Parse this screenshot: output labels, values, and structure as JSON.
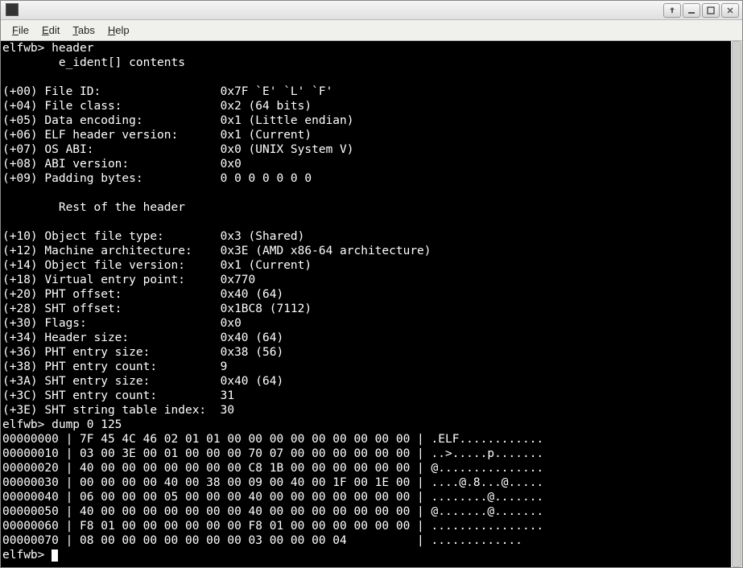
{
  "menubar": {
    "file": "File",
    "edit": "Edit",
    "tabs": "Tabs",
    "help": "Help"
  },
  "terminal": {
    "prompt1": "elfwb> ",
    "cmd1": "header",
    "h_ident": "        e_ident[] contents",
    "rows_ident": [
      "(+00) File ID:                 0x7F `E' `L' `F'",
      "(+04) File class:              0x2 (64 bits)",
      "(+05) Data encoding:           0x1 (Little endian)",
      "(+06) ELF header version:      0x1 (Current)",
      "(+07) OS ABI:                  0x0 (UNIX System V)",
      "(+08) ABI version:             0x0",
      "(+09) Padding bytes:           0 0 0 0 0 0 0"
    ],
    "h_rest": "        Rest of the header",
    "rows_rest": [
      "(+10) Object file type:        0x3 (Shared)",
      "(+12) Machine architecture:    0x3E (AMD x86-64 architecture)",
      "(+14) Object file version:     0x1 (Current)",
      "(+18) Virtual entry point:     0x770",
      "(+20) PHT offset:              0x40 (64)",
      "(+28) SHT offset:              0x1BC8 (7112)",
      "(+30) Flags:                   0x0",
      "(+34) Header size:             0x40 (64)",
      "(+36) PHT entry size:          0x38 (56)",
      "(+38) PHT entry count:         9",
      "(+3A) SHT entry size:          0x40 (64)",
      "(+3C) SHT entry count:         31",
      "(+3E) SHT string table index:  30"
    ],
    "prompt2": "elfwb> ",
    "cmd2": "dump 0 125",
    "dump": [
      "00000000 | 7F 45 4C 46 02 01 01 00 00 00 00 00 00 00 00 00 | .ELF............",
      "00000010 | 03 00 3E 00 01 00 00 00 70 07 00 00 00 00 00 00 | ..>.....p.......",
      "00000020 | 40 00 00 00 00 00 00 00 C8 1B 00 00 00 00 00 00 | @...............",
      "00000030 | 00 00 00 00 40 00 38 00 09 00 40 00 1F 00 1E 00 | ....@.8...@.....",
      "00000040 | 06 00 00 00 05 00 00 00 40 00 00 00 00 00 00 00 | ........@.......",
      "00000050 | 40 00 00 00 00 00 00 00 40 00 00 00 00 00 00 00 | @.......@.......",
      "00000060 | F8 01 00 00 00 00 00 00 F8 01 00 00 00 00 00 00 | ................",
      "00000070 | 08 00 00 00 00 00 00 00 03 00 00 00 04          | ............."
    ],
    "prompt3": "elfwb> "
  }
}
